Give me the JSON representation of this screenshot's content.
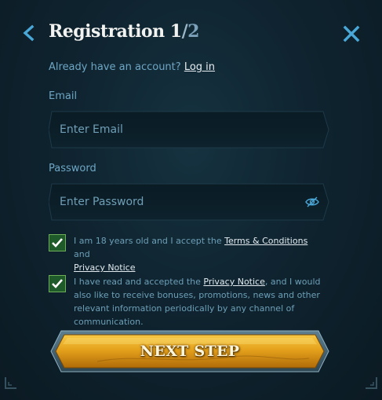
{
  "header": {
    "title_main": "Registration 1",
    "title_sep": "/",
    "title_total": "2",
    "back_icon": "chevron-left-icon",
    "close_icon": "close-icon"
  },
  "login_prompt": {
    "text": "Already have an account?",
    "link": "Log in"
  },
  "email": {
    "label": "Email",
    "placeholder": "Enter Email",
    "value": ""
  },
  "password": {
    "label": "Password",
    "placeholder": "Enter Password",
    "value": "",
    "toggle_icon": "eye-off-icon"
  },
  "consents": [
    {
      "checked": true,
      "text_before": "I am 18 years old and I accept the ",
      "link1": "Terms & Conditions",
      "text_middle": " and ",
      "link2": "Privacy Notice",
      "text_after": ""
    },
    {
      "checked": true,
      "text_before": "I have read and accepted the ",
      "link1": "Privacy Notice",
      "text_after": ", and I would also like to receive bonuses, promotions, news and other relevant information periodically by any channel of communication."
    }
  ],
  "next_button": {
    "label": "NEXT STEP"
  },
  "colors": {
    "background": "#0f2430",
    "accent_blue": "#6ea6c4",
    "button_gold": "#e5a21c",
    "checkbox_green": "#1f5a2a"
  }
}
